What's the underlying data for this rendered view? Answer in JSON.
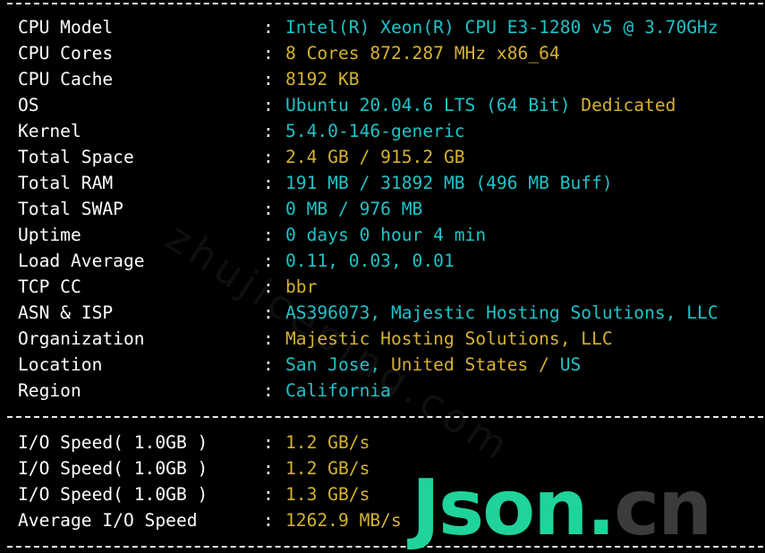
{
  "system_info": [
    {
      "label": "CPU Model",
      "parts": [
        {
          "text": "Intel(R) Xeon(R) CPU E3-1280 v5 @ 3.70GHz",
          "color": "c"
        }
      ]
    },
    {
      "label": "CPU Cores",
      "parts": [
        {
          "text": "8 Cores 872.287 MHz x86_64",
          "color": "y"
        }
      ]
    },
    {
      "label": "CPU Cache",
      "parts": [
        {
          "text": "8192 KB",
          "color": "y"
        }
      ]
    },
    {
      "label": "OS",
      "parts": [
        {
          "text": "Ubuntu 20.04.6 LTS (64 Bit)",
          "color": "c"
        },
        {
          "text": " Dedicated",
          "color": "y"
        }
      ]
    },
    {
      "label": "Kernel",
      "parts": [
        {
          "text": "5.4.0-146-generic",
          "color": "c"
        }
      ]
    },
    {
      "label": "Total Space",
      "parts": [
        {
          "text": "2.4 GB",
          "color": "y"
        },
        {
          "text": " / ",
          "color": "y"
        },
        {
          "text": "915.2 GB",
          "color": "y"
        }
      ]
    },
    {
      "label": "Total RAM",
      "parts": [
        {
          "text": "191 MB / 31892 MB (496 MB Buff)",
          "color": "c"
        }
      ]
    },
    {
      "label": "Total SWAP",
      "parts": [
        {
          "text": "0 MB / 976 MB",
          "color": "c"
        }
      ]
    },
    {
      "label": "Uptime",
      "parts": [
        {
          "text": "0 days 0 hour 4 min",
          "color": "c"
        }
      ]
    },
    {
      "label": "Load Average",
      "parts": [
        {
          "text": "0.11, 0.03, 0.01",
          "color": "c"
        }
      ]
    },
    {
      "label": "TCP CC",
      "parts": [
        {
          "text": "bbr",
          "color": "y"
        }
      ]
    },
    {
      "label": "ASN & ISP",
      "parts": [
        {
          "text": "AS396073, Majestic Hosting Solutions, LLC",
          "color": "c"
        }
      ]
    },
    {
      "label": "Organization",
      "parts": [
        {
          "text": "Majestic Hosting Solutions, LLC",
          "color": "y"
        }
      ]
    },
    {
      "label": "Location",
      "parts": [
        {
          "text": "San Jose, ",
          "color": "c"
        },
        {
          "text": "United States",
          "color": "y"
        },
        {
          "text": " / ",
          "color": "y"
        },
        {
          "text": "US",
          "color": "c"
        }
      ]
    },
    {
      "label": "Region",
      "parts": [
        {
          "text": "California",
          "color": "c"
        }
      ]
    }
  ],
  "io_speed": [
    {
      "label": "I/O Speed( 1.0GB )",
      "parts": [
        {
          "text": "1.2 GB/s",
          "color": "y"
        }
      ]
    },
    {
      "label": "I/O Speed( 1.0GB )",
      "parts": [
        {
          "text": "1.2 GB/s",
          "color": "y"
        }
      ]
    },
    {
      "label": "I/O Speed( 1.0GB )",
      "parts": [
        {
          "text": "1.3 GB/s",
          "color": "y"
        }
      ]
    },
    {
      "label": "Average I/O Speed",
      "parts": [
        {
          "text": "1262.9 MB/s",
          "color": "y"
        }
      ]
    }
  ],
  "colon": ":",
  "colors": {
    "cyan": "#1ec3c8",
    "yellow": "#d6b22e",
    "text": "#ffffff",
    "background": "#000000"
  },
  "watermark": {
    "faint": "zhujiceping.com",
    "logo_main": "Json",
    "logo_dot": ".",
    "logo_tld": "cn"
  }
}
